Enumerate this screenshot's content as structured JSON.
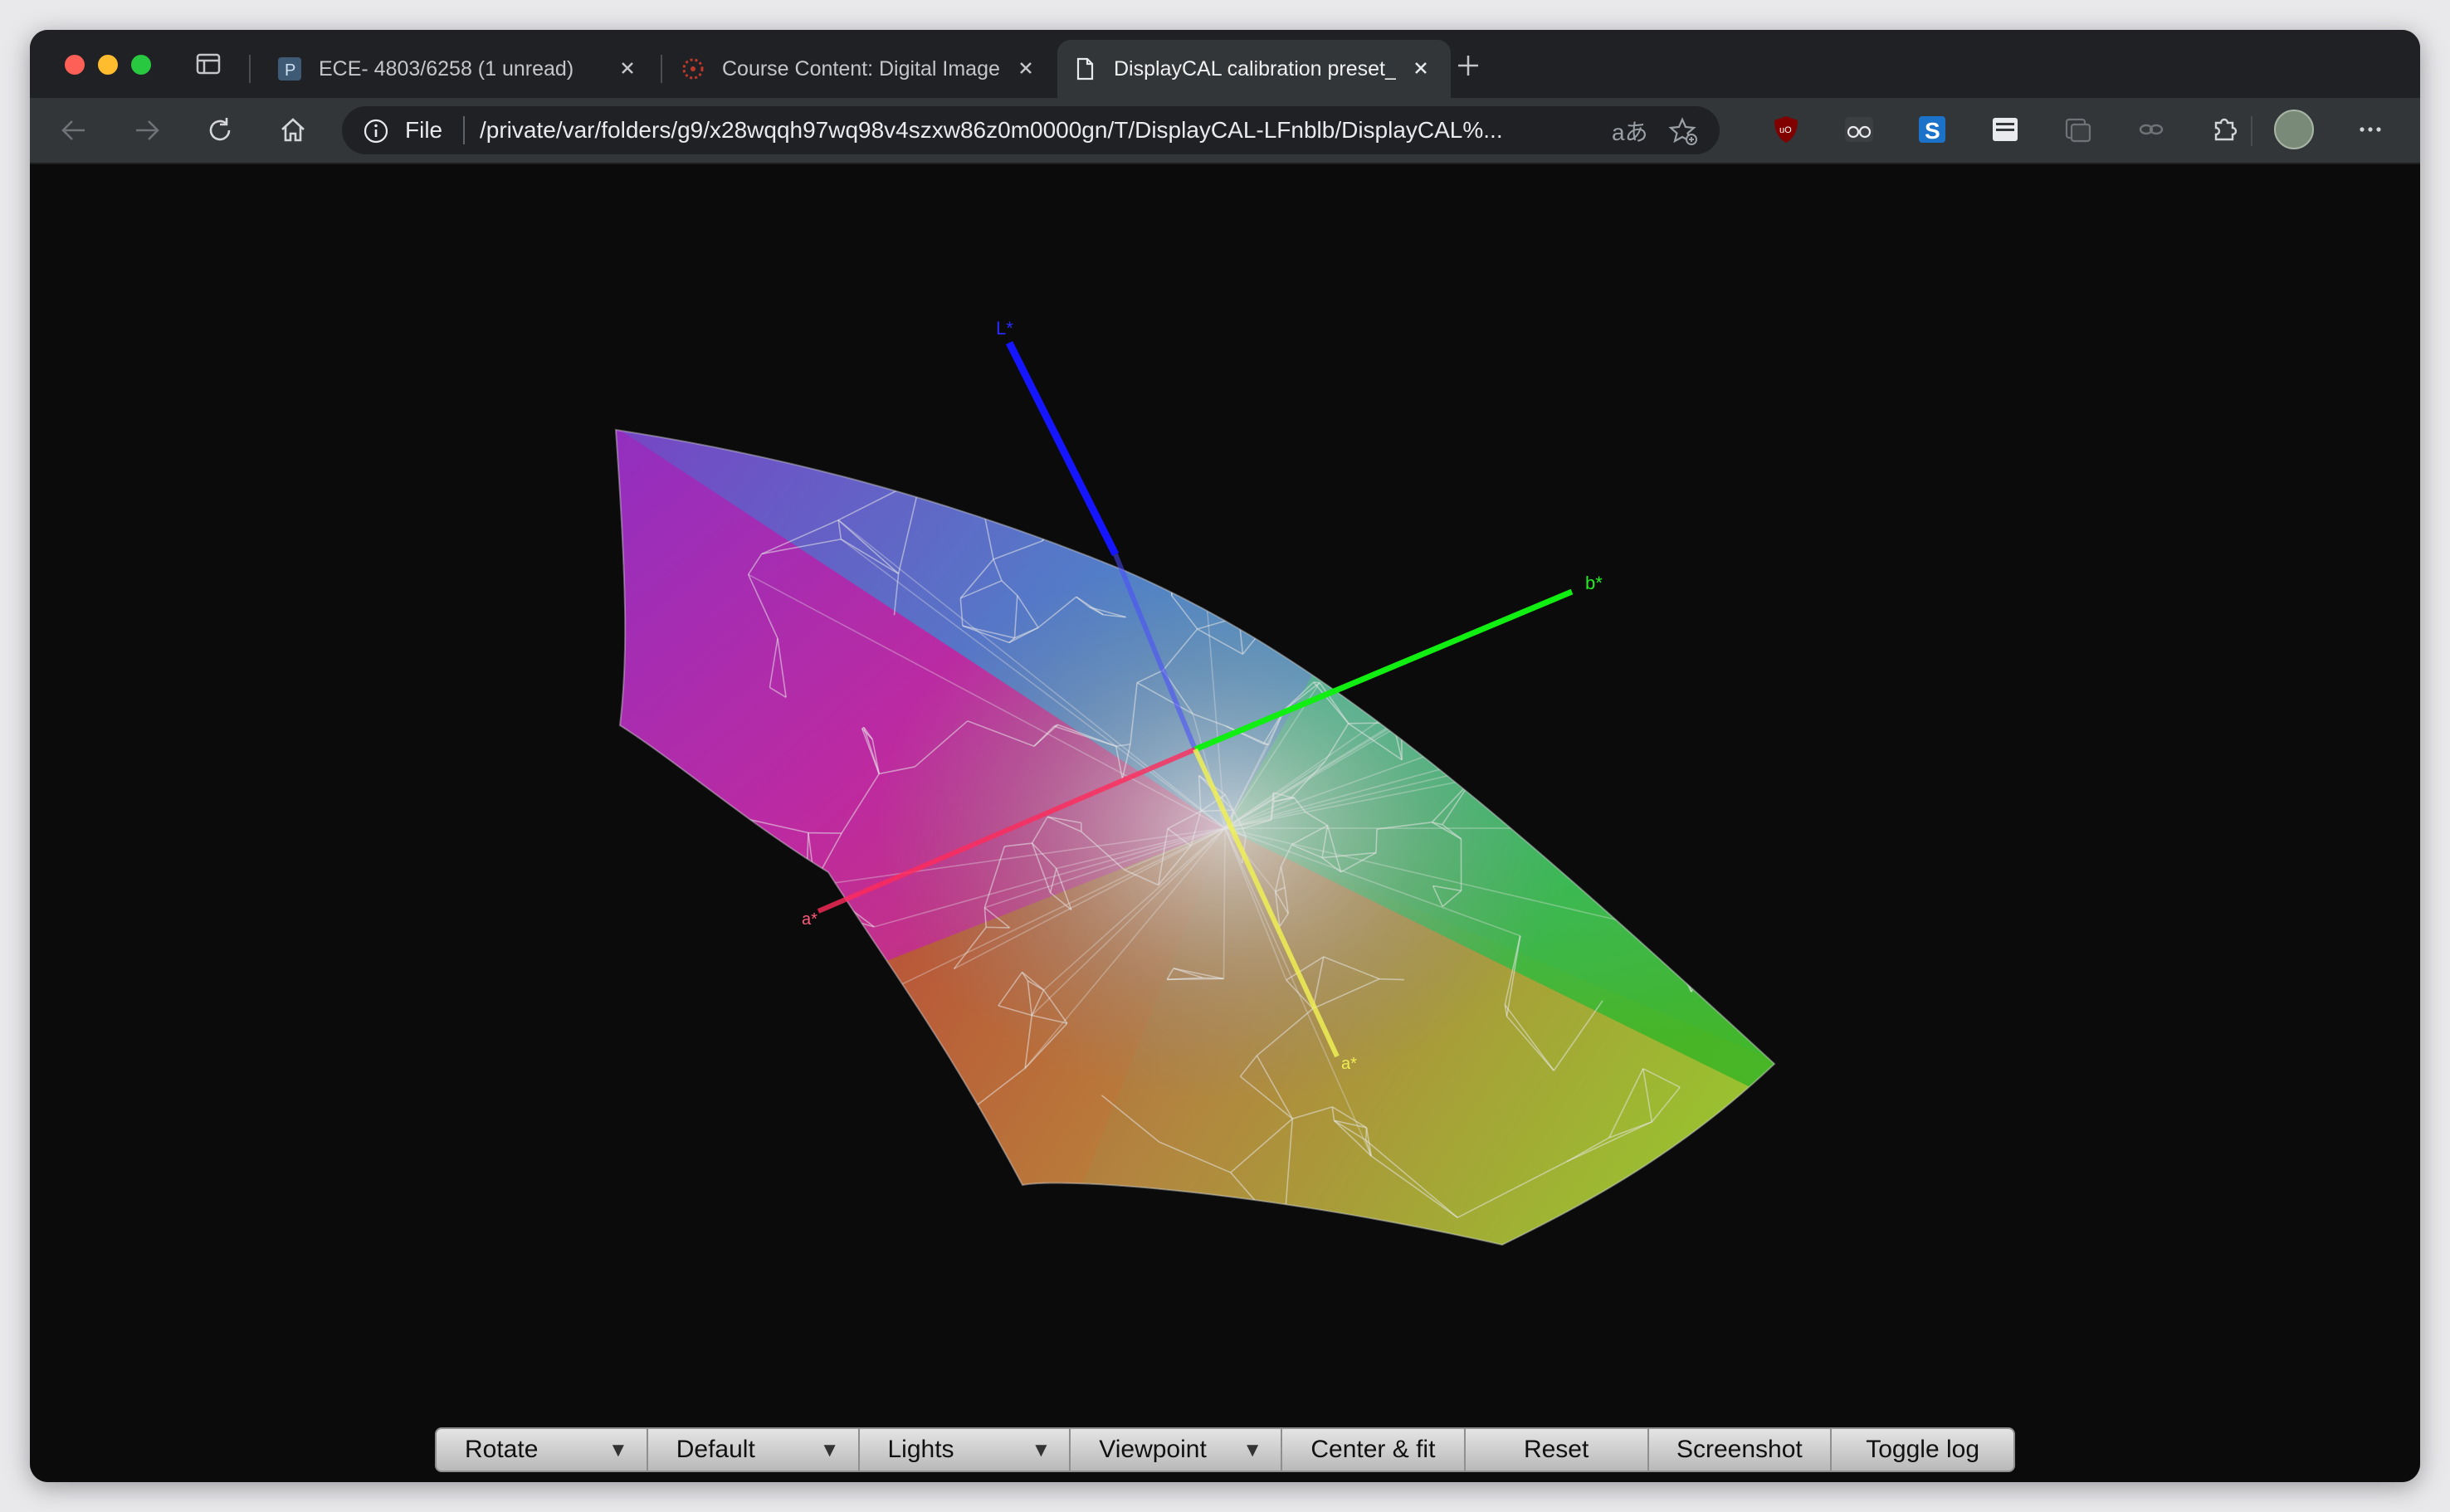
{
  "browser": {
    "tabs": [
      {
        "title": "ECE- 4803/6258 (1 unread)",
        "icon": "piazza-icon",
        "active": false
      },
      {
        "title": "Course Content: Digital Image",
        "icon": "canvas-icon",
        "active": false
      },
      {
        "title": "DisplayCAL calibration preset_",
        "icon": "document-icon",
        "active": true
      }
    ],
    "address": {
      "scheme": "File",
      "url": "/private/var/folders/g9/x28wqqh97wq98v4szxw86z0m0000gn/T/DisplayCAL-LFnblb/DisplayCAL%...",
      "translate_glyph": "aあ"
    },
    "extensions": [
      "ublock-icon",
      "glasses-icon",
      "s-extension-icon",
      "reader-icon",
      "collections-icon",
      "link-icon",
      "puzzle-icon"
    ]
  },
  "viewer": {
    "axes": [
      {
        "name": "L*",
        "color": "#1515ff"
      },
      {
        "name": "b*",
        "color": "#11ee11"
      },
      {
        "name": "a*",
        "color": "#ff2a5a"
      },
      {
        "name": "a*",
        "color": "#eeee55"
      }
    ],
    "controls": [
      {
        "label": "Rotate",
        "dropdown": true
      },
      {
        "label": "Default",
        "dropdown": true
      },
      {
        "label": "Lights",
        "dropdown": true
      },
      {
        "label": "Viewpoint",
        "dropdown": true
      },
      {
        "label": "Center & fit",
        "dropdown": false
      },
      {
        "label": "Reset",
        "dropdown": false
      },
      {
        "label": "Screenshot",
        "dropdown": false
      },
      {
        "label": "Toggle log",
        "dropdown": false
      }
    ],
    "dropdown_glyph": "▼"
  }
}
